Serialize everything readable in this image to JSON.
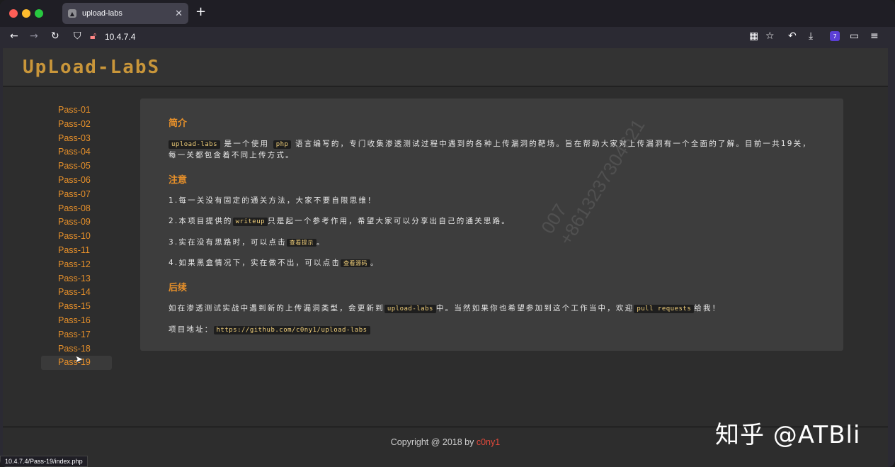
{
  "browser": {
    "tab_title": "upload-labs",
    "url": "10.4.7.4",
    "extension_badge": "7",
    "status_url": "10.4.7.4/Pass-19/index.php"
  },
  "site": {
    "logo_text": "UpLoad-LabS",
    "nav": [
      {
        "label": "Pass-01"
      },
      {
        "label": "Pass-02"
      },
      {
        "label": "Pass-03"
      },
      {
        "label": "Pass-04"
      },
      {
        "label": "Pass-05"
      },
      {
        "label": "Pass-06"
      },
      {
        "label": "Pass-07"
      },
      {
        "label": "Pass-08"
      },
      {
        "label": "Pass-09"
      },
      {
        "label": "Pass-10"
      },
      {
        "label": "Pass-11"
      },
      {
        "label": "Pass-12"
      },
      {
        "label": "Pass-13"
      },
      {
        "label": "Pass-14"
      },
      {
        "label": "Pass-15"
      },
      {
        "label": "Pass-16"
      },
      {
        "label": "Pass-17"
      },
      {
        "label": "Pass-18"
      },
      {
        "label": "Pass-19"
      }
    ],
    "active_nav": "Pass-19"
  },
  "intro": {
    "title": "简介",
    "code1": "upload-labs",
    "text1": "是一个使用",
    "code2": "php",
    "text2": "语言编写的，专门收集渗透测试过程中遇到的各种上传漏洞的靶场。旨在帮助大家对上传漏洞有一个全面的了解。目前一共19关，每一关都包含着不同上传方式。"
  },
  "notes": {
    "title": "注意",
    "item1": "1.每一关没有固定的通关方法，大家不要自限思维！",
    "item2_pre": "2.本项目提供的",
    "item2_code": "writeup",
    "item2_post": "只是起一个参考作用，希望大家可以分享出自己的通关思路。",
    "item3_pre": "3.实在没有思路时，可以点击",
    "item3_btn": "查看提示",
    "item3_post": "。",
    "item4_pre": "4.如果黑盒情况下，实在做不出，可以点击",
    "item4_btn": "查看源码",
    "item4_post": "。"
  },
  "followup": {
    "title": "后续",
    "text_pre": "如在渗透测试实战中遇到新的上传漏洞类型，会更新到",
    "code1": "upload-labs",
    "text_mid": "中。当然如果你也希望参加到这个工作当中，欢迎",
    "code2": "pull requests",
    "text_post": "给我！",
    "addr_label": "项目地址：",
    "addr_url": "https://github.com/c0ny1/upload-labs"
  },
  "watermark": {
    "line1": "007",
    "line2": "+8613237304621"
  },
  "footer": {
    "prefix": "Copyright @ 2018 by ",
    "author": "c0ny1"
  },
  "overlay": {
    "zhihu": "知乎 @ATBli"
  },
  "colors": {
    "accent": "#e7902a",
    "author": "#e44a3b"
  }
}
